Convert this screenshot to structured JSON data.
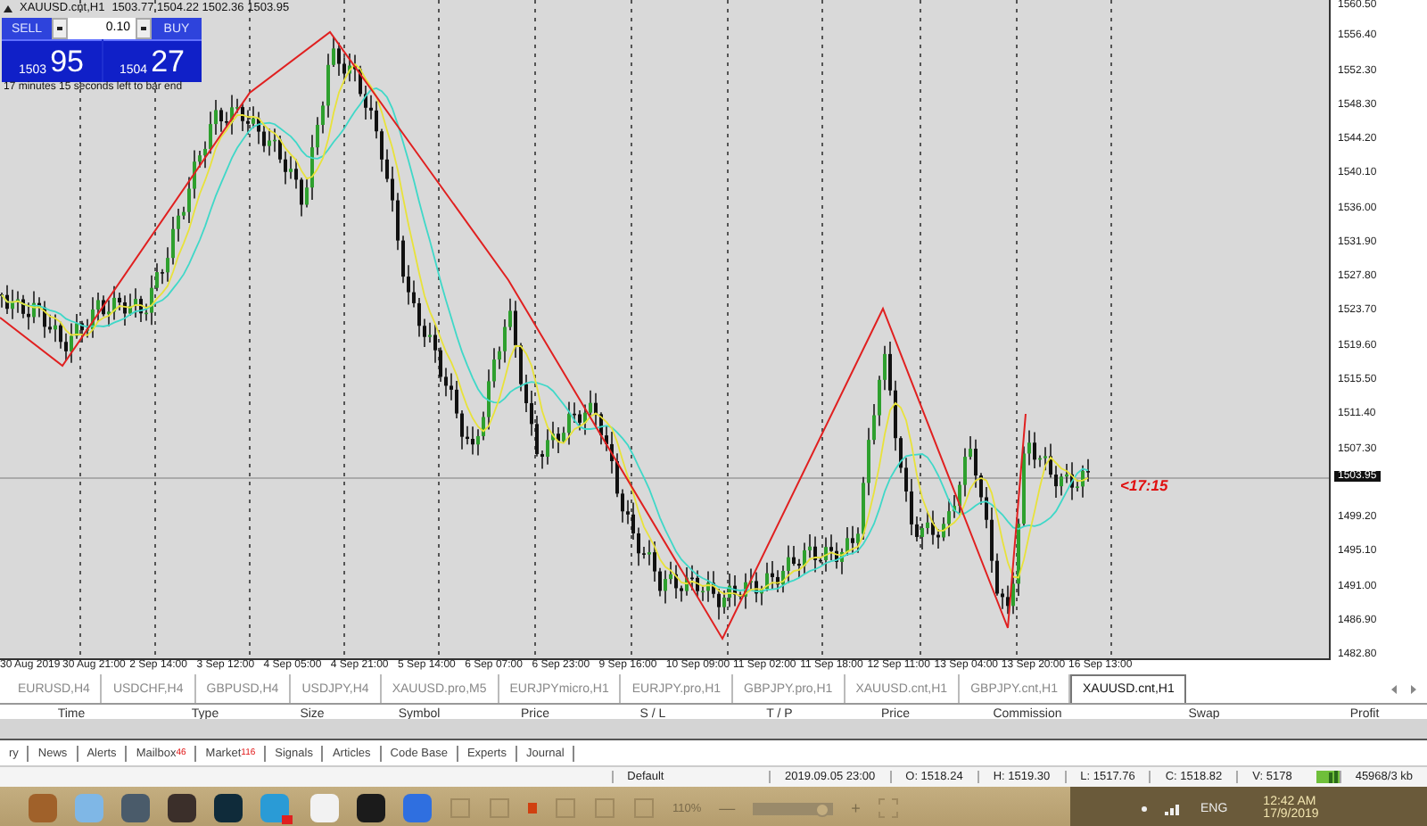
{
  "chart": {
    "symbol": "XAUUSD.cnt,H1",
    "ohlc": "1503.77 1504.22 1502.36 1503.95",
    "trade_panel": {
      "sell_label": "SELL",
      "buy_label": "BUY",
      "lot": "0.10",
      "sell_price_major": "1503",
      "sell_price_minor": "95",
      "buy_price_major": "1504",
      "buy_price_minor": "27"
    },
    "bar_timer": "17 minutes 15 seconds left to bar end",
    "countdown": "<17:15",
    "current_price": "1503.95",
    "price_axis": [
      "1560.50",
      "1556.40",
      "1552.30",
      "1548.30",
      "1544.20",
      "1540.10",
      "1536.00",
      "1531.90",
      "1527.80",
      "1523.70",
      "1519.60",
      "1515.50",
      "1511.40",
      "1507.30",
      "1499.20",
      "1495.10",
      "1491.00",
      "1486.90",
      "1482.80"
    ],
    "time_axis": [
      "30 Aug 2019",
      "30 Aug 21:00",
      "2 Sep 14:00",
      "3 Sep 12:00",
      "4 Sep 05:00",
      "4 Sep 21:00",
      "5 Sep 14:00",
      "6 Sep 07:00",
      "6 Sep 23:00",
      "9 Sep 16:00",
      "10 Sep 09:00",
      "11 Sep 02:00",
      "11 Sep 18:00",
      "12 Sep 11:00",
      "13 Sep 04:00",
      "13 Sep 20:00",
      "16 Sep 13:00"
    ]
  },
  "chart_tabs": [
    {
      "label": "EURUSD,H4",
      "selected": false
    },
    {
      "label": "USDCHF,H4",
      "selected": false
    },
    {
      "label": "GBPUSD,H4",
      "selected": false
    },
    {
      "label": "USDJPY,H4",
      "selected": false
    },
    {
      "label": "XAUUSD.pro,M5",
      "selected": false
    },
    {
      "label": "EURJPYmicro,H1",
      "selected": false
    },
    {
      "label": "EURJPY.pro,H1",
      "selected": false
    },
    {
      "label": "GBPJPY.pro,H1",
      "selected": false
    },
    {
      "label": "XAUUSD.cnt,H1",
      "selected": false
    },
    {
      "label": "GBPJPY.cnt,H1",
      "selected": false
    },
    {
      "label": "XAUUSD.cnt,H1",
      "selected": true
    }
  ],
  "terminal": {
    "columns": [
      "Time",
      "Type",
      "Size",
      "Symbol",
      "Price",
      "S / L",
      "T / P",
      "Price",
      "Commission",
      "Swap",
      "Profit"
    ],
    "tabs": [
      {
        "label": "ry"
      },
      {
        "label": "News"
      },
      {
        "label": "Alerts"
      },
      {
        "label": "Mailbox",
        "badge": "46"
      },
      {
        "label": "Market",
        "badge": "116"
      },
      {
        "label": "Signals"
      },
      {
        "label": "Articles"
      },
      {
        "label": "Code Base"
      },
      {
        "label": "Experts"
      },
      {
        "label": "Journal"
      }
    ]
  },
  "status_bar": {
    "profile": "Default",
    "bar_time": "2019.09.05 23:00",
    "open": "O: 1518.24",
    "high": "H: 1519.30",
    "low": "L: 1517.76",
    "close": "C: 1518.82",
    "volume": "V: 5178",
    "traffic": "45968/3 kb"
  },
  "taskbar": {
    "zoom": "110%",
    "zoom_level": {
      "level": 0.85
    },
    "zoom_out": "—",
    "zoom_in": "+",
    "language": "ENG",
    "clock": "12:42 AM",
    "date": "17/9/2019"
  }
}
